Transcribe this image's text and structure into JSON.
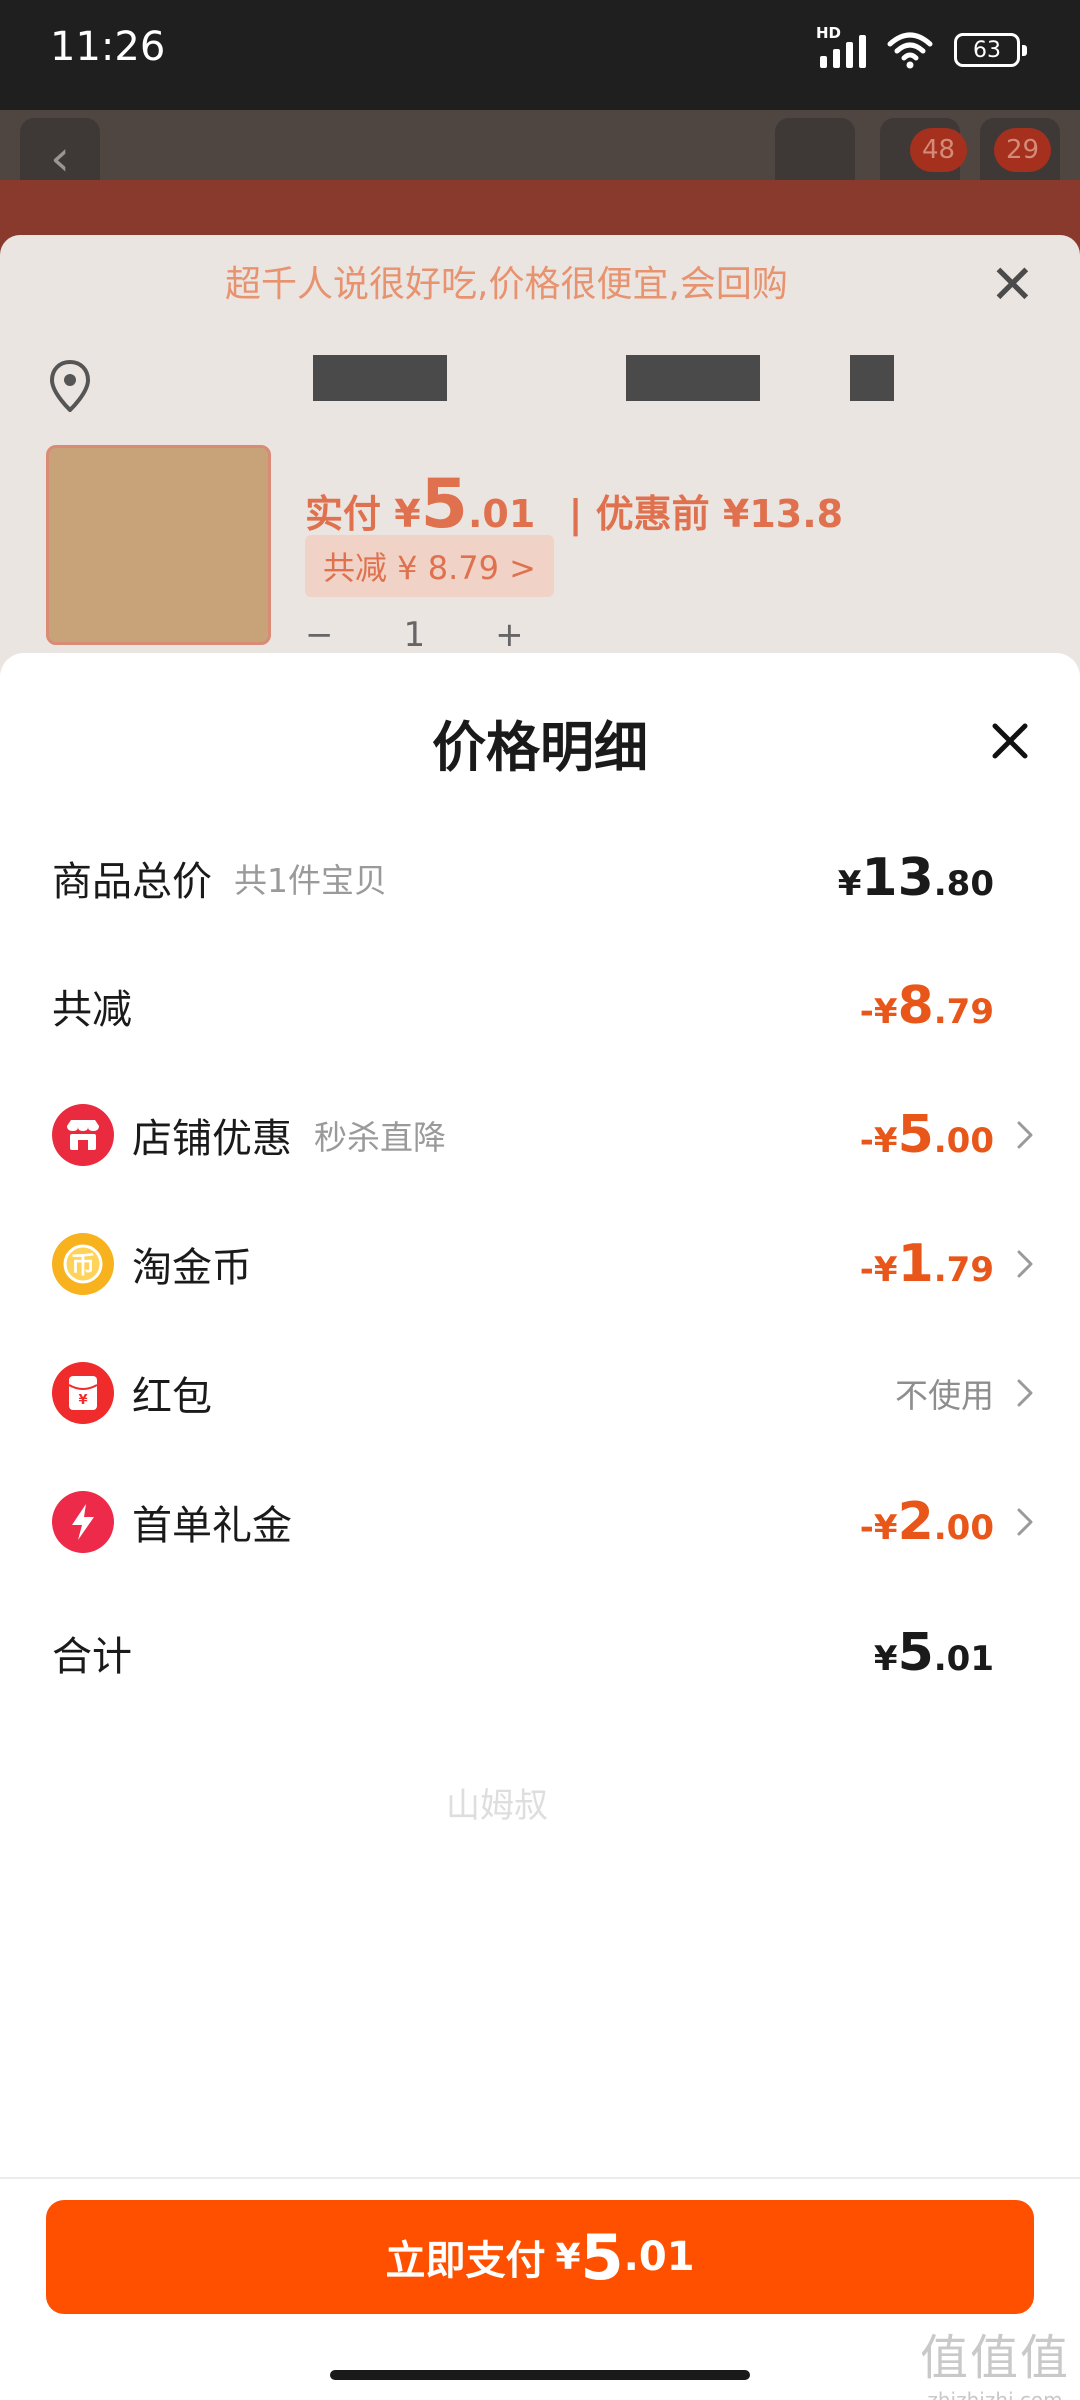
{
  "status": {
    "time": "11:26",
    "hd": "HD",
    "battery": "63"
  },
  "background": {
    "cart_badge": "48",
    "msg_badge": "29",
    "review": "超千人说很好吃,价格很便宜,会回购",
    "price_label": "实付 ¥",
    "price_int": "5",
    "price_dec": ".01",
    "price_before": "| 优惠前 ¥13.8",
    "discount_tag": "共减 ¥ 8.79 >",
    "quantity": "1"
  },
  "sheet": {
    "title": "价格明细",
    "rows": {
      "total": {
        "label": "商品总价",
        "sub": "共1件宝贝",
        "yen": "¥",
        "int": "13",
        "dec": ".80"
      },
      "reduce": {
        "label": "共减",
        "yen": "-¥",
        "int": "8",
        "dec": ".79"
      },
      "shop": {
        "label": "店铺优惠",
        "sub": "秒杀直降",
        "yen": "-¥",
        "int": "5",
        "dec": ".00"
      },
      "coin": {
        "label": "淘金币",
        "yen": "-¥",
        "int": "1",
        "dec": ".79"
      },
      "redpack": {
        "label": "红包",
        "value": "不使用"
      },
      "firstorder": {
        "label": "首单礼金",
        "yen": "-¥",
        "int": "2",
        "dec": ".00"
      },
      "sum": {
        "label": "合计",
        "yen": "¥",
        "int": "5",
        "dec": ".01"
      }
    },
    "watermark": "山姆叔",
    "pay_button": {
      "label": "立即支付",
      "yen": "¥",
      "int": "5",
      "dec": ".01"
    }
  },
  "corner_mark": {
    "glyphs": "值值值",
    "site": "zhizhizhi.com"
  },
  "colors": {
    "accent": "#ff5000",
    "discount": "#e8561a"
  }
}
